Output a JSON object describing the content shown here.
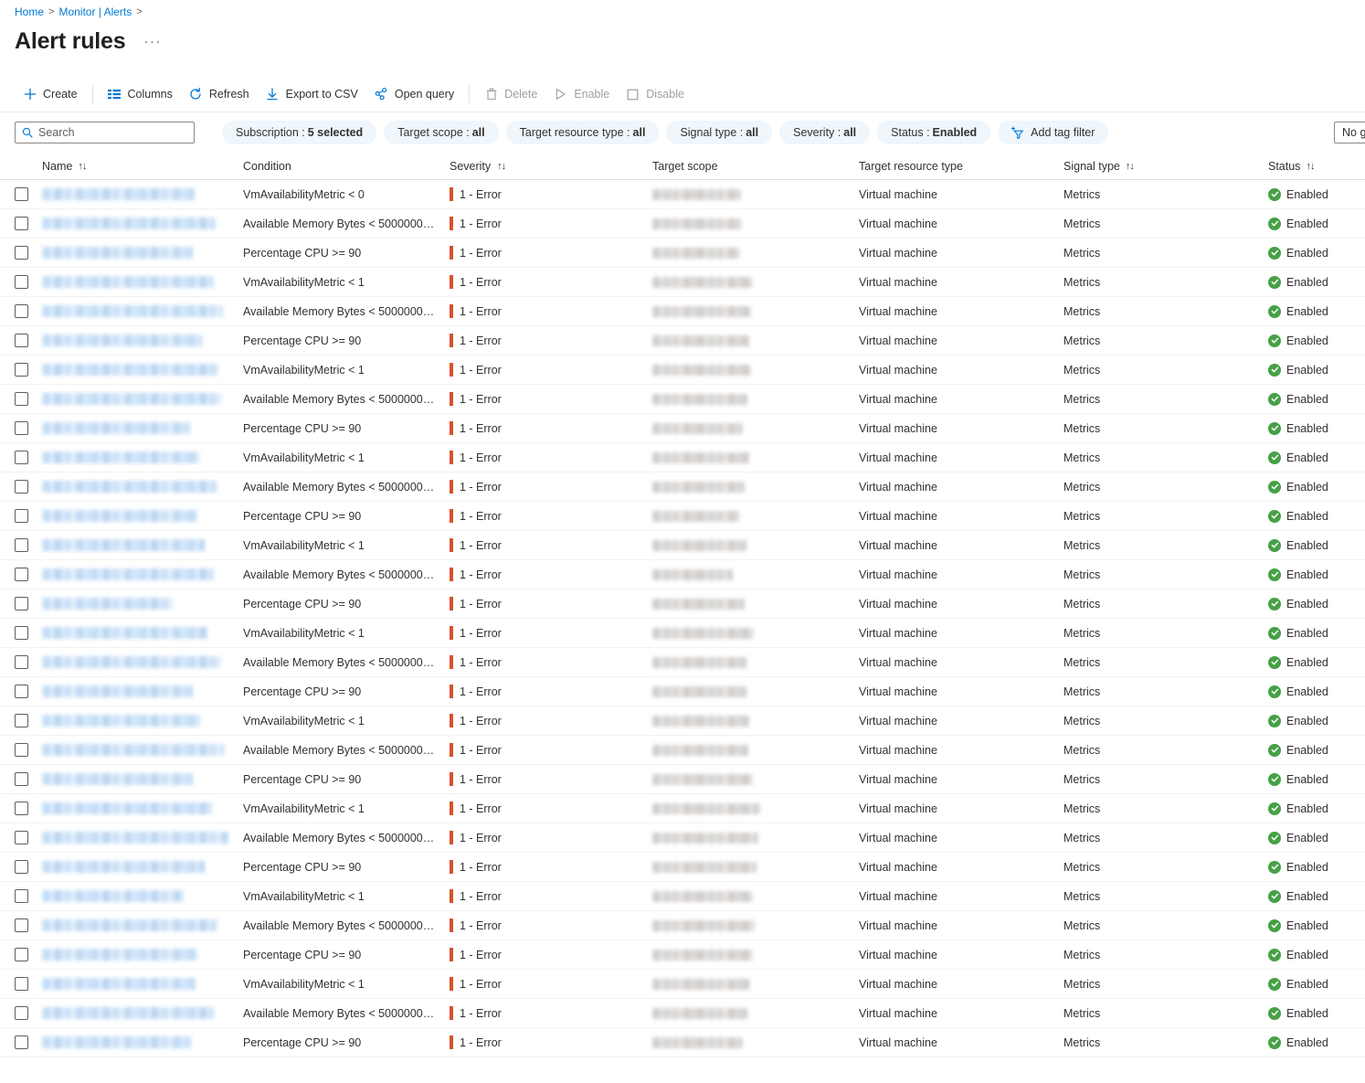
{
  "breadcrumb": {
    "items": [
      {
        "label": "Home"
      },
      {
        "label": "Monitor | Alerts"
      }
    ],
    "separator": ">"
  },
  "header": {
    "title": "Alert rules",
    "more_menu": "···"
  },
  "toolbar": {
    "items": [
      {
        "label": "Create",
        "icon": "plus-icon",
        "disabled": false
      },
      {
        "label": "Columns",
        "icon": "columns-icon",
        "disabled": false
      },
      {
        "label": "Refresh",
        "icon": "refresh-icon",
        "disabled": false
      },
      {
        "label": "Export to CSV",
        "icon": "download-icon",
        "disabled": false
      },
      {
        "label": "Open query",
        "icon": "open-query-icon",
        "disabled": false
      },
      {
        "label": "Delete",
        "icon": "trash-icon",
        "disabled": true
      },
      {
        "label": "Enable",
        "icon": "play-icon",
        "disabled": true
      },
      {
        "label": "Disable",
        "icon": "stop-icon",
        "disabled": true
      }
    ]
  },
  "search": {
    "placeholder": "Search",
    "value": "",
    "icon": "search-icon"
  },
  "filters": [
    {
      "label": "Subscription :",
      "value": "5 selected"
    },
    {
      "label": "Target scope :",
      "value": "all"
    },
    {
      "label": "Target resource type :",
      "value": "all"
    },
    {
      "label": "Signal type :",
      "value": "all"
    },
    {
      "label": "Severity :",
      "value": "all"
    },
    {
      "label": "Status :",
      "value": "Enabled"
    }
  ],
  "add_tag_filter": {
    "label": "Add tag filter",
    "icon": "add-filter-icon"
  },
  "grouping": {
    "value": "No grouping"
  },
  "table": {
    "columns": [
      {
        "label": "Name",
        "sortable": true
      },
      {
        "label": "Condition",
        "sortable": false
      },
      {
        "label": "Severity",
        "sortable": true
      },
      {
        "label": "Target scope",
        "sortable": false
      },
      {
        "label": "Target resource type",
        "sortable": false
      },
      {
        "label": "Signal type",
        "sortable": true
      },
      {
        "label": "Status",
        "sortable": true
      }
    ],
    "rows": [
      {
        "name": "",
        "name_redacted": true,
        "name_width": 167,
        "condition": "VmAvailabilityMetric < 0",
        "severity": "1 - Error",
        "scope": "",
        "scope_redacted": true,
        "scope_width": 97,
        "target_resource_type": "Virtual machine",
        "signal_type": "Metrics",
        "status": "Enabled"
      },
      {
        "name": "",
        "name_redacted": true,
        "name_width": 190,
        "condition": "Available Memory Bytes < 5000000…",
        "severity": "1 - Error",
        "scope": "",
        "scope_redacted": true,
        "scope_width": 97,
        "target_resource_type": "Virtual machine",
        "signal_type": "Metrics",
        "status": "Enabled"
      },
      {
        "name": "",
        "name_redacted": true,
        "name_width": 165,
        "condition": "Percentage CPU >= 90",
        "severity": "1 - Error",
        "scope": "",
        "scope_redacted": true,
        "scope_width": 95,
        "target_resource_type": "Virtual machine",
        "signal_type": "Metrics",
        "status": "Enabled"
      },
      {
        "name": "",
        "name_redacted": true,
        "name_width": 188,
        "condition": "VmAvailabilityMetric < 1",
        "severity": "1 - Error",
        "scope": "",
        "scope_redacted": true,
        "scope_width": 110,
        "target_resource_type": "Virtual machine",
        "signal_type": "Metrics",
        "status": "Enabled"
      },
      {
        "name": "",
        "name_redacted": true,
        "name_width": 198,
        "condition": "Available Memory Bytes < 5000000…",
        "severity": "1 - Error",
        "scope": "",
        "scope_redacted": true,
        "scope_width": 108,
        "target_resource_type": "Virtual machine",
        "signal_type": "Metrics",
        "status": "Enabled"
      },
      {
        "name": "",
        "name_redacted": true,
        "name_width": 175,
        "condition": "Percentage CPU >= 90",
        "severity": "1 - Error",
        "scope": "",
        "scope_redacted": true,
        "scope_width": 106,
        "target_resource_type": "Virtual machine",
        "signal_type": "Metrics",
        "status": "Enabled"
      },
      {
        "name": "",
        "name_redacted": true,
        "name_width": 193,
        "condition": "VmAvailabilityMetric < 1",
        "severity": "1 - Error",
        "scope": "",
        "scope_redacted": true,
        "scope_width": 108,
        "target_resource_type": "Virtual machine",
        "signal_type": "Metrics",
        "status": "Enabled"
      },
      {
        "name": "",
        "name_redacted": true,
        "name_width": 196,
        "condition": "Available Memory Bytes < 5000000…",
        "severity": "1 - Error",
        "scope": "",
        "scope_redacted": true,
        "scope_width": 104,
        "target_resource_type": "Virtual machine",
        "signal_type": "Metrics",
        "status": "Enabled"
      },
      {
        "name": "",
        "name_redacted": true,
        "name_width": 162,
        "condition": "Percentage CPU >= 90",
        "severity": "1 - Error",
        "scope": "",
        "scope_redacted": true,
        "scope_width": 99,
        "target_resource_type": "Virtual machine",
        "signal_type": "Metrics",
        "status": "Enabled"
      },
      {
        "name": "",
        "name_redacted": true,
        "name_width": 172,
        "condition": "VmAvailabilityMetric < 1",
        "severity": "1 - Error",
        "scope": "",
        "scope_redacted": true,
        "scope_width": 106,
        "target_resource_type": "Virtual machine",
        "signal_type": "Metrics",
        "status": "Enabled"
      },
      {
        "name": "",
        "name_redacted": true,
        "name_width": 192,
        "condition": "Available Memory Bytes < 5000000…",
        "severity": "1 - Error",
        "scope": "",
        "scope_redacted": true,
        "scope_width": 101,
        "target_resource_type": "Virtual machine",
        "signal_type": "Metrics",
        "status": "Enabled"
      },
      {
        "name": "",
        "name_redacted": true,
        "name_width": 170,
        "condition": "Percentage CPU >= 90",
        "severity": "1 - Error",
        "scope": "",
        "scope_redacted": true,
        "scope_width": 95,
        "target_resource_type": "Virtual machine",
        "signal_type": "Metrics",
        "status": "Enabled"
      },
      {
        "name": "",
        "name_redacted": true,
        "name_width": 178,
        "condition": "VmAvailabilityMetric < 1",
        "severity": "1 - Error",
        "scope": "",
        "scope_redacted": true,
        "scope_width": 103,
        "target_resource_type": "Virtual machine",
        "signal_type": "Metrics",
        "status": "Enabled"
      },
      {
        "name": "",
        "name_redacted": true,
        "name_width": 188,
        "condition": "Available Memory Bytes < 5000000…",
        "severity": "1 - Error",
        "scope": "",
        "scope_redacted": true,
        "scope_width": 88,
        "target_resource_type": "Virtual machine",
        "signal_type": "Metrics",
        "status": "Enabled"
      },
      {
        "name": "",
        "name_redacted": true,
        "name_width": 143,
        "condition": "Percentage CPU >= 90",
        "severity": "1 - Error",
        "scope": "",
        "scope_redacted": true,
        "scope_width": 101,
        "target_resource_type": "Virtual machine",
        "signal_type": "Metrics",
        "status": "Enabled"
      },
      {
        "name": "",
        "name_redacted": true,
        "name_width": 181,
        "condition": "VmAvailabilityMetric < 1",
        "severity": "1 - Error",
        "scope": "",
        "scope_redacted": true,
        "scope_width": 111,
        "target_resource_type": "Virtual machine",
        "signal_type": "Metrics",
        "status": "Enabled"
      },
      {
        "name": "",
        "name_redacted": true,
        "name_width": 196,
        "condition": "Available Memory Bytes < 5000000…",
        "severity": "1 - Error",
        "scope": "",
        "scope_redacted": true,
        "scope_width": 103,
        "target_resource_type": "Virtual machine",
        "signal_type": "Metrics",
        "status": "Enabled"
      },
      {
        "name": "",
        "name_redacted": true,
        "name_width": 165,
        "condition": "Percentage CPU >= 90",
        "severity": "1 - Error",
        "scope": "",
        "scope_redacted": true,
        "scope_width": 103,
        "target_resource_type": "Virtual machine",
        "signal_type": "Metrics",
        "status": "Enabled"
      },
      {
        "name": "",
        "name_redacted": true,
        "name_width": 173,
        "condition": "VmAvailabilityMetric < 1",
        "severity": "1 - Error",
        "scope": "",
        "scope_redacted": true,
        "scope_width": 106,
        "target_resource_type": "Virtual machine",
        "signal_type": "Metrics",
        "status": "Enabled"
      },
      {
        "name": "",
        "name_redacted": true,
        "name_width": 199,
        "condition": "Available Memory Bytes < 5000000…",
        "severity": "1 - Error",
        "scope": "",
        "scope_redacted": true,
        "scope_width": 105,
        "target_resource_type": "Virtual machine",
        "signal_type": "Metrics",
        "status": "Enabled"
      },
      {
        "name": "",
        "name_redacted": true,
        "name_width": 165,
        "condition": "Percentage CPU >= 90",
        "severity": "1 - Error",
        "scope": "",
        "scope_redacted": true,
        "scope_width": 110,
        "target_resource_type": "Virtual machine",
        "signal_type": "Metrics",
        "status": "Enabled"
      },
      {
        "name": "",
        "name_redacted": true,
        "name_width": 186,
        "condition": "VmAvailabilityMetric < 1",
        "severity": "1 - Error",
        "scope": "",
        "scope_redacted": true,
        "scope_width": 118,
        "target_resource_type": "Virtual machine",
        "signal_type": "Metrics",
        "status": "Enabled"
      },
      {
        "name": "",
        "name_redacted": true,
        "name_width": 204,
        "condition": "Available Memory Bytes < 5000000…",
        "severity": "1 - Error",
        "scope": "",
        "scope_redacted": true,
        "scope_width": 116,
        "target_resource_type": "Virtual machine",
        "signal_type": "Metrics",
        "status": "Enabled"
      },
      {
        "name": "",
        "name_redacted": true,
        "name_width": 178,
        "condition": "Percentage CPU >= 90",
        "severity": "1 - Error",
        "scope": "",
        "scope_redacted": true,
        "scope_width": 114,
        "target_resource_type": "Virtual machine",
        "signal_type": "Metrics",
        "status": "Enabled"
      },
      {
        "name": "",
        "name_redacted": true,
        "name_width": 155,
        "condition": "VmAvailabilityMetric < 1",
        "severity": "1 - Error",
        "scope": "",
        "scope_redacted": true,
        "scope_width": 110,
        "target_resource_type": "Virtual machine",
        "signal_type": "Metrics",
        "status": "Enabled"
      },
      {
        "name": "",
        "name_redacted": true,
        "name_width": 192,
        "condition": "Available Memory Bytes < 5000000…",
        "severity": "1 - Error",
        "scope": "",
        "scope_redacted": true,
        "scope_width": 112,
        "target_resource_type": "Virtual machine",
        "signal_type": "Metrics",
        "status": "Enabled"
      },
      {
        "name": "",
        "name_redacted": true,
        "name_width": 170,
        "condition": "Percentage CPU >= 90",
        "severity": "1 - Error",
        "scope": "",
        "scope_redacted": true,
        "scope_width": 110,
        "target_resource_type": "Virtual machine",
        "signal_type": "Metrics",
        "status": "Enabled"
      },
      {
        "name": "",
        "name_redacted": true,
        "name_width": 168,
        "condition": "VmAvailabilityMetric < 1",
        "severity": "1 - Error",
        "scope": "",
        "scope_redacted": true,
        "scope_width": 107,
        "target_resource_type": "Virtual machine",
        "signal_type": "Metrics",
        "status": "Enabled"
      },
      {
        "name": "",
        "name_redacted": true,
        "name_width": 188,
        "condition": "Available Memory Bytes < 5000000…",
        "severity": "1 - Error",
        "scope": "",
        "scope_redacted": true,
        "scope_width": 104,
        "target_resource_type": "Virtual machine",
        "signal_type": "Metrics",
        "status": "Enabled"
      },
      {
        "name": "",
        "name_redacted": true,
        "name_width": 163,
        "condition": "Percentage CPU >= 90",
        "severity": "1 - Error",
        "scope": "",
        "scope_redacted": true,
        "scope_width": 99,
        "target_resource_type": "Virtual machine",
        "signal_type": "Metrics",
        "status": "Enabled"
      }
    ]
  },
  "colors": {
    "accent": "#0078d4",
    "severity_error": "#d9512c",
    "status_enabled": "#46a146",
    "pill_bg": "#eff6fc"
  }
}
